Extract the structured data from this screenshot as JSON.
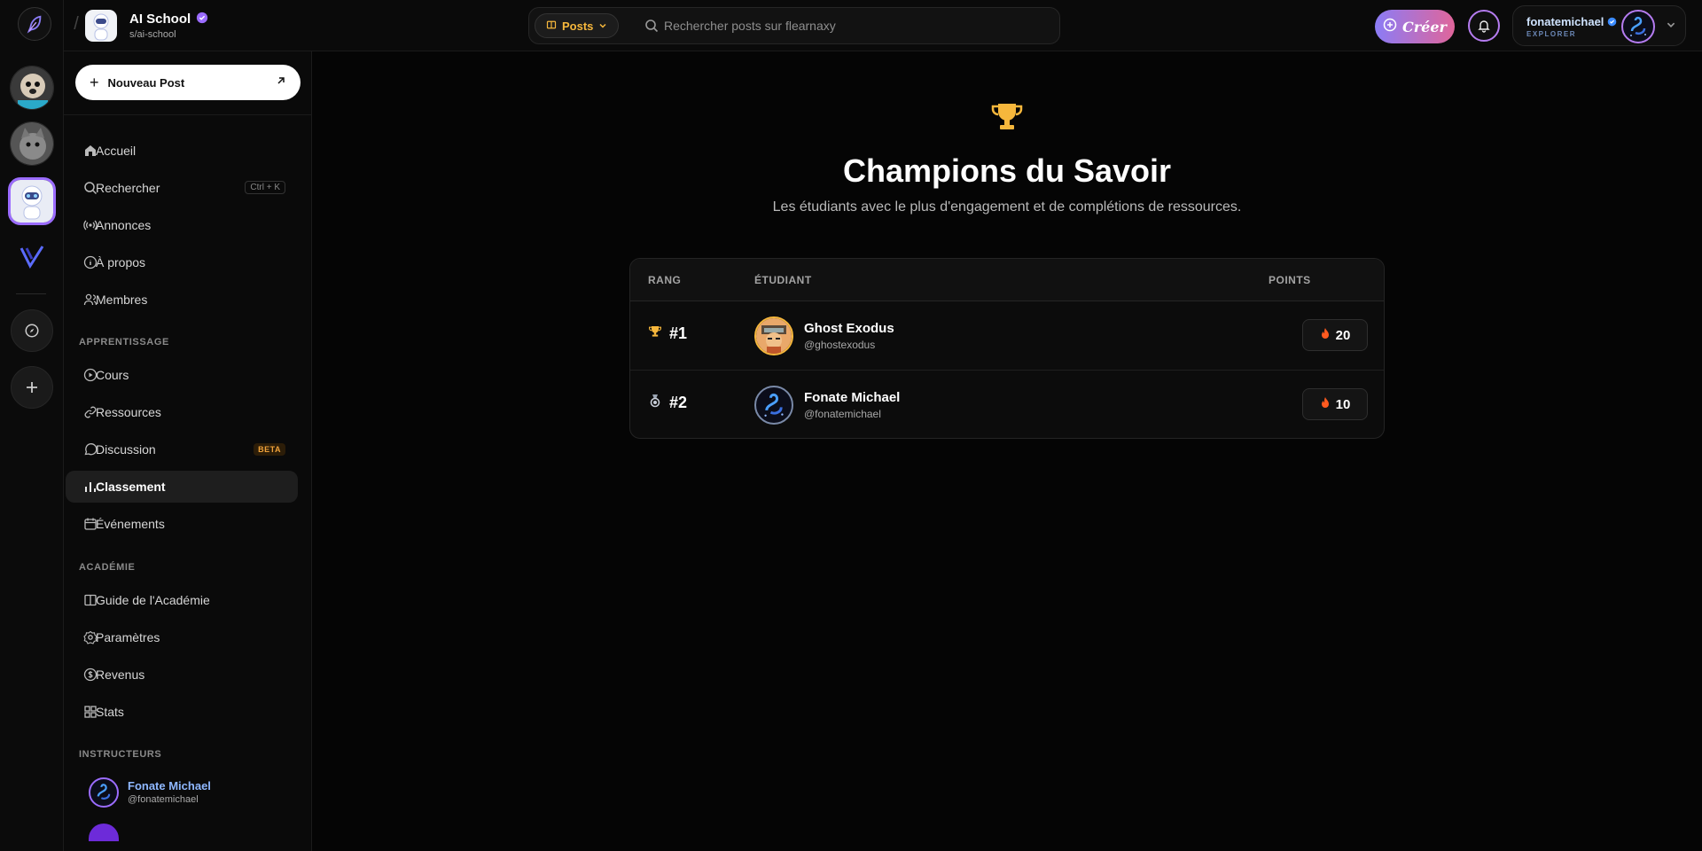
{
  "colors": {
    "accent": "#9b6cff",
    "gold": "#f6b73c",
    "fire": "#ff5a1f",
    "create_from": "#8b7cf6",
    "create_to": "#e0659a"
  },
  "header": {
    "school_name": "AI School",
    "school_handle": "s/ai-school",
    "posts_label": "Posts",
    "search_placeholder": "Rechercher posts sur flearnaxy",
    "create_label": "Créer",
    "user_name": "fonatemichael",
    "user_role": "EXPLORER"
  },
  "sidebar": {
    "new_post_label": "Nouveau Post",
    "items": [
      {
        "label": "Accueil",
        "icon": "home-icon"
      },
      {
        "label": "Rechercher",
        "icon": "search-icon",
        "shortcut": "Ctrl + K"
      },
      {
        "label": "Annonces",
        "icon": "broadcast-icon"
      },
      {
        "label": "À propos",
        "icon": "info-icon"
      },
      {
        "label": "Membres",
        "icon": "users-icon"
      }
    ],
    "section_learning": "APPRENTISSAGE",
    "learning": [
      {
        "label": "Cours",
        "icon": "play-circle-icon"
      },
      {
        "label": "Ressources",
        "icon": "link-icon"
      },
      {
        "label": "Discussion",
        "icon": "chat-icon",
        "badge": "BETA"
      },
      {
        "label": "Classement",
        "icon": "bar-chart-icon",
        "active": true
      },
      {
        "label": "Événements",
        "icon": "calendar-icon"
      }
    ],
    "section_academy": "ACADÉMIE",
    "academy": [
      {
        "label": "Guide de l'Académie",
        "icon": "book-icon"
      },
      {
        "label": "Paramètres",
        "icon": "settings-icon"
      },
      {
        "label": "Revenus",
        "icon": "dollar-circle-icon"
      },
      {
        "label": "Stats",
        "icon": "grid-icon"
      }
    ],
    "section_instructors": "INSTRUCTEURS",
    "instructor": {
      "name": "Fonate Michael",
      "handle": "@fonatemichael"
    }
  },
  "main": {
    "title": "Champions du Savoir",
    "subtitle": "Les étudiants avec le plus d'engagement et de complétions de ressources.",
    "columns": {
      "rank": "RANG",
      "student": "ÉTUDIANT",
      "points": "POINTS"
    },
    "rows": [
      {
        "rank": "#1",
        "rank_icon": "trophy-icon",
        "name": "Ghost Exodus",
        "handle": "@ghostexodus",
        "points": "20"
      },
      {
        "rank": "#2",
        "rank_icon": "medal-icon",
        "name": "Fonate Michael",
        "handle": "@fonatemichael",
        "points": "10"
      }
    ]
  }
}
